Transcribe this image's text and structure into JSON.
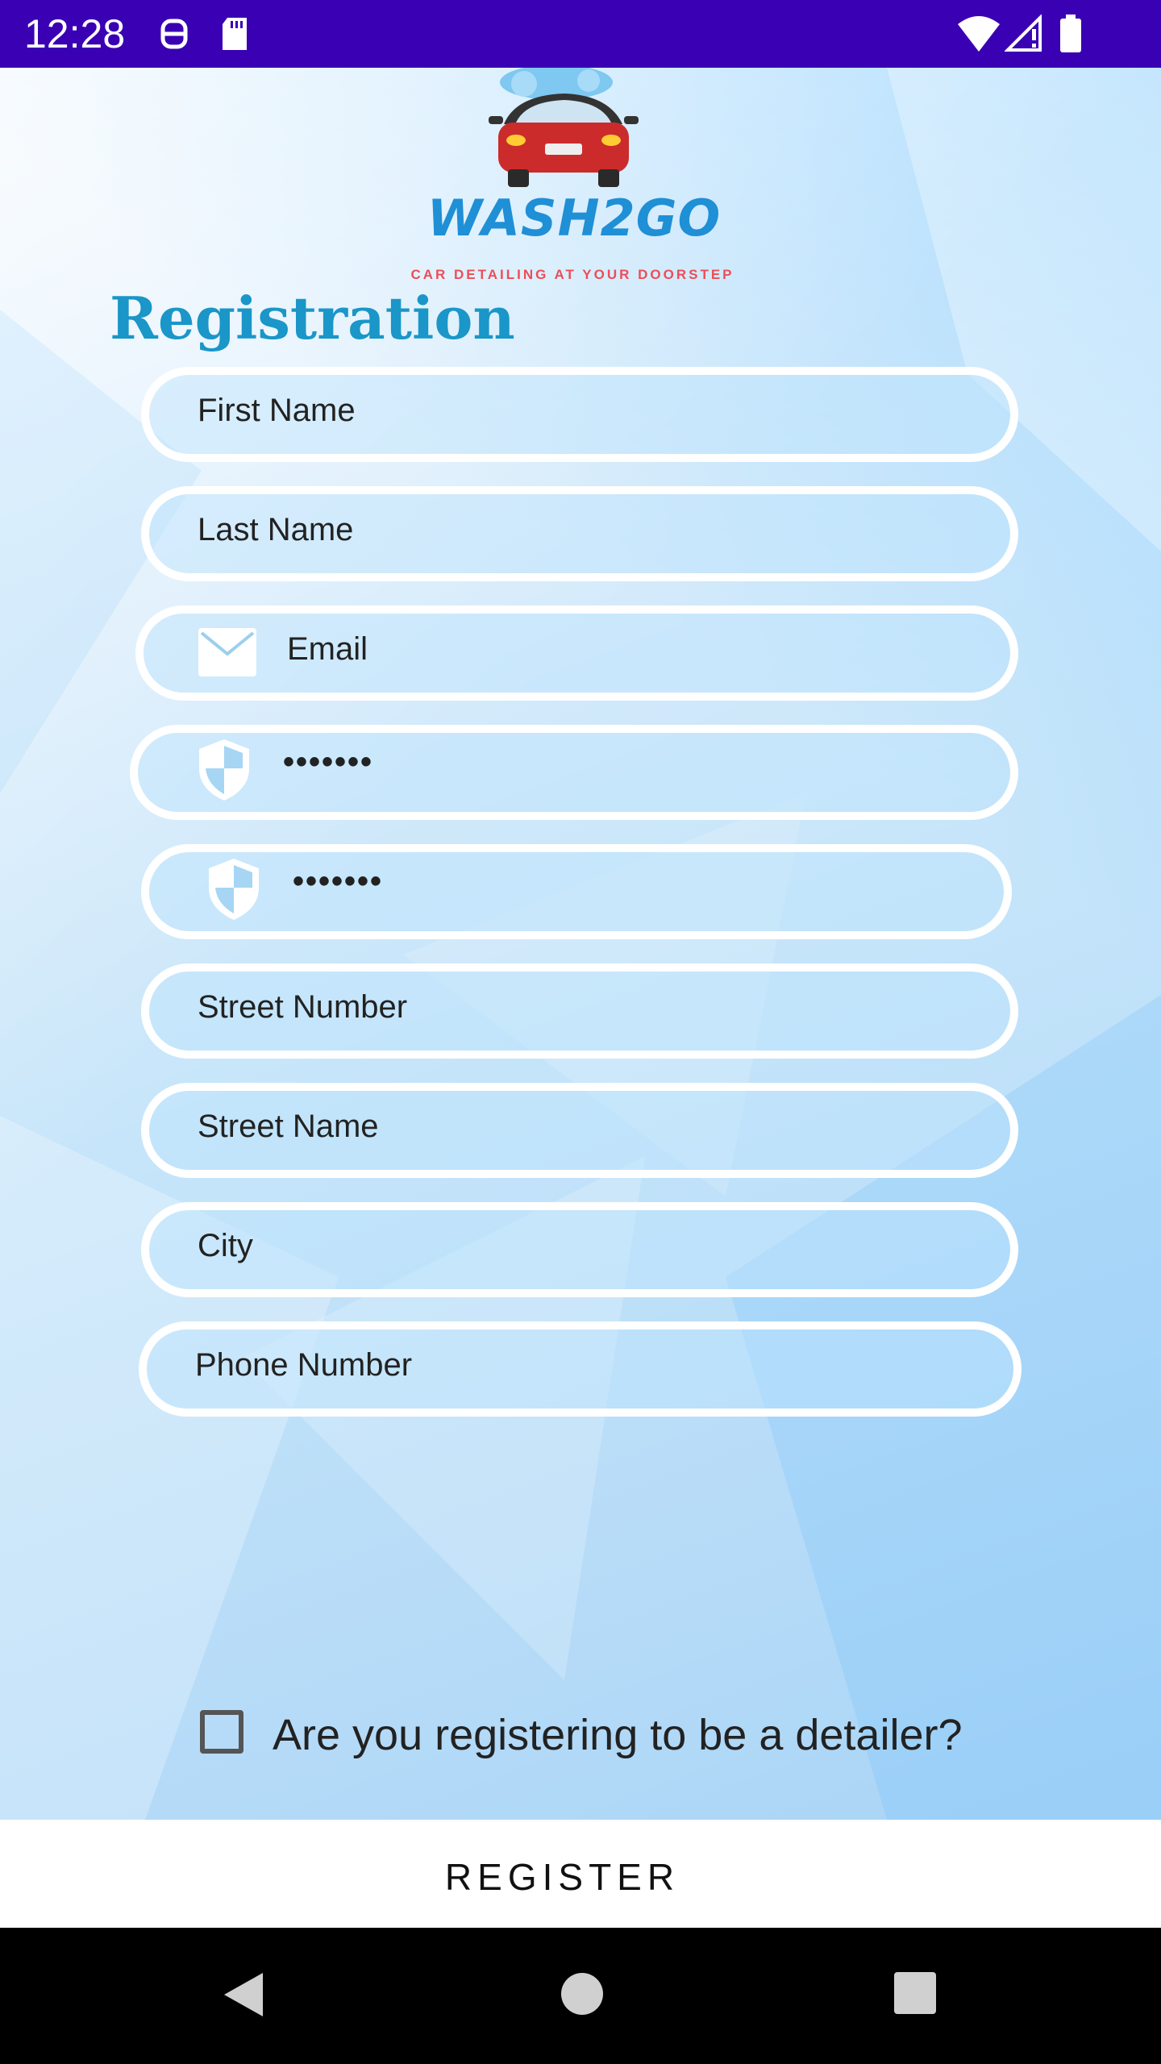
{
  "status_bar": {
    "time": "12:28"
  },
  "brand": {
    "name": "WASH2GO",
    "tagline": "CAR DETAILING AT YOUR DOORSTEP"
  },
  "page_title": "Registration",
  "form": {
    "first_name_placeholder": "First Name",
    "last_name_placeholder": "Last Name",
    "email_placeholder": "Email",
    "password_value": "•••••••",
    "confirm_password_value": "•••••••",
    "street_number_placeholder": "Street Number",
    "street_name_placeholder": "Street Name",
    "city_placeholder": "City",
    "phone_placeholder": "Phone Number",
    "detailer_checkbox_label": "Are you registering to be a detailer?",
    "detailer_checked": false
  },
  "register_button_label": "REGISTER",
  "colors": {
    "status_bar": "#3a00b3",
    "title": "#1a96c8",
    "brand_blue": "#1f8fd6",
    "tagline_red": "#ee4d57"
  },
  "icons": {
    "email": "envelope-icon",
    "password": "shield-icon",
    "nav_back": "back-triangle-icon",
    "nav_home": "home-circle-icon",
    "nav_recents": "recents-square-icon"
  }
}
